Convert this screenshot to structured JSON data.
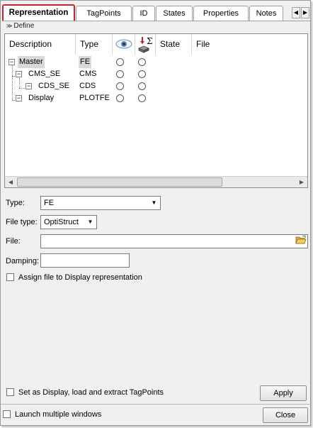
{
  "tabs": [
    {
      "label": "Representation",
      "active": true
    },
    {
      "label": "TagPoints"
    },
    {
      "label": "ID"
    },
    {
      "label": "States"
    },
    {
      "label": "Properties"
    },
    {
      "label": "Notes"
    }
  ],
  "tab_scroll": {
    "left_icon": "scroll-left-icon",
    "right_icon": "scroll-right-icon"
  },
  "define_label": "Define",
  "grid": {
    "columns": [
      "Description",
      "Type",
      "",
      "",
      "State",
      "File"
    ],
    "column_icons": {
      "visibility": "eye-icon",
      "load_extract": "load-sum-icon"
    },
    "rows": [
      {
        "description": "Master",
        "type": "FE",
        "selected": true
      },
      {
        "description": "CMS_SE",
        "type": "CMS"
      },
      {
        "description": "CDS_SE",
        "type": "CDS"
      },
      {
        "description": "Display",
        "type": "PLOTFE"
      }
    ]
  },
  "form": {
    "type_label": "Type:",
    "type_value": "FE",
    "file_type_label": "File type:",
    "file_type_value": "OptiStruct",
    "file_label": "File:",
    "file_value": "",
    "damping_label": "Damping:",
    "damping_value": "",
    "assign_label": "Assign file to Display representation"
  },
  "footer": {
    "set_display_label": "Set as Display, load and extract TagPoints",
    "apply_label": "Apply",
    "launch_label": "Launch multiple windows",
    "close_label": "Close"
  },
  "colors": {
    "active_tab_border": "#c0272d",
    "selection": "#d8d8d8"
  }
}
